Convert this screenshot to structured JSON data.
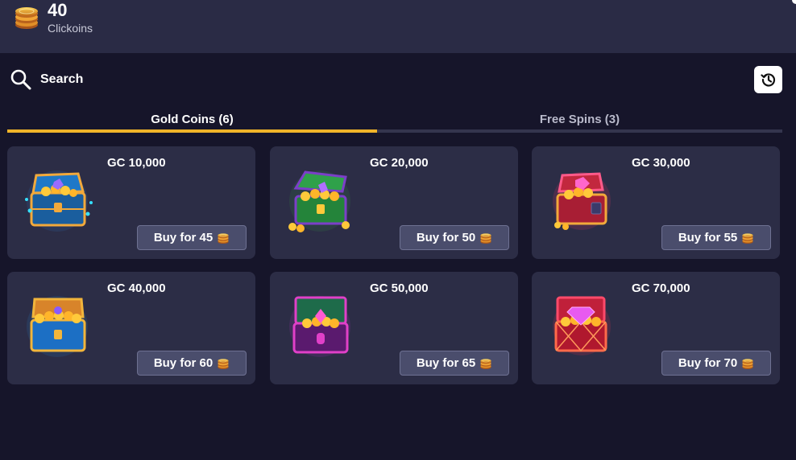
{
  "header": {
    "balance_value": "40",
    "balance_unit": "Clickoins",
    "coin_icon": "coin-stack-icon"
  },
  "search": {
    "label": "Search",
    "icon": "search-icon"
  },
  "history_button": {
    "icon": "history-icon"
  },
  "tabs": [
    {
      "label": "Gold Coins (6)",
      "active": true
    },
    {
      "label": "Free Spins (3)",
      "active": false
    }
  ],
  "colors": {
    "background": "#16152a",
    "header": "#2a2b45",
    "card": "#2c2d46",
    "accent": "#f0b429",
    "button": "#4a4d6c"
  },
  "packages": [
    {
      "title": "GC 10,000",
      "buy_label": "Buy for 45",
      "chest_icon": "blue-treasure-chest-icon"
    },
    {
      "title": "GC 20,000",
      "buy_label": "Buy for 50",
      "chest_icon": "green-treasure-chest-icon"
    },
    {
      "title": "GC 30,000",
      "buy_label": "Buy for 55",
      "chest_icon": "red-treasure-chest-icon"
    },
    {
      "title": "GC 40,000",
      "buy_label": "Buy for 60",
      "chest_icon": "blue-gold-treasure-chest-icon"
    },
    {
      "title": "GC 50,000",
      "buy_label": "Buy for 65",
      "chest_icon": "purple-treasure-chest-icon"
    },
    {
      "title": "GC 70,000",
      "buy_label": "Buy for 70",
      "chest_icon": "diamond-treasure-chest-icon"
    }
  ]
}
